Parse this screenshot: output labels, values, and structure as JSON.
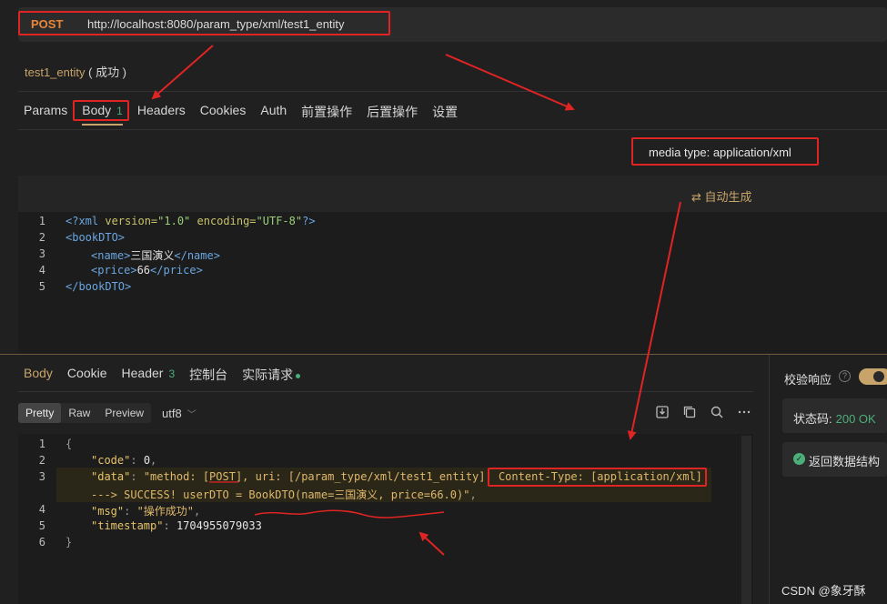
{
  "request": {
    "method": "POST",
    "url": "http://localhost:8080/param_type/xml/test1_entity",
    "name": "test1_entity",
    "status": "( 成功 )",
    "tabs": [
      {
        "label": "Params"
      },
      {
        "label": "Body",
        "badge": "1"
      },
      {
        "label": "Headers"
      },
      {
        "label": "Cookies"
      },
      {
        "label": "Auth"
      },
      {
        "label": "前置操作"
      },
      {
        "label": "后置操作"
      },
      {
        "label": "设置"
      }
    ],
    "media_type": "media type: application/xml",
    "autogen_label": "自动生成",
    "body_lines": [
      {
        "n": "1"
      },
      {
        "n": "2"
      },
      {
        "n": "3"
      },
      {
        "n": "4"
      },
      {
        "n": "5"
      }
    ],
    "xml": {
      "decl_open": "<?xml",
      "version_attr": " version=",
      "version_val": "\"1.0\"",
      "encoding_attr": " encoding=",
      "encoding_val": "\"UTF-8\"",
      "decl_close": "?>",
      "root_open": "<bookDTO>",
      "name_open": "<name>",
      "name_val": "三国演义",
      "name_close": "</name>",
      "price_open": "<price>",
      "price_val": "66",
      "price_close": "</price>",
      "root_close": "</bookDTO>"
    }
  },
  "response": {
    "tabs": [
      {
        "label": "Body"
      },
      {
        "label": "Cookie"
      },
      {
        "label": "Header",
        "badge": "3"
      },
      {
        "label": "控制台"
      },
      {
        "label": "实际请求"
      }
    ],
    "view_modes": [
      "Pretty",
      "Raw",
      "Preview"
    ],
    "encoding": "utf8",
    "line_numbers": [
      "1",
      "2",
      "3",
      "",
      "4",
      "5",
      "6"
    ],
    "json": {
      "open": "{",
      "code_key": "\"code\"",
      "code_val": "0",
      "data_key": "\"data\"",
      "data_val_1": "\"method: [POST], uri: [/param_type/xml/test1_entity], Content-Type: [application/xml]",
      "data_val_2": "---> SUCCESS! userDTO = BookDTO(name=三国演义, price=66.0)\"",
      "msg_key": "\"msg\"",
      "msg_val": "\"操作成功\"",
      "ts_key": "\"timestamp\"",
      "ts_val": "1704955079033",
      "close": "}"
    }
  },
  "side_panel": {
    "verify_label": "校验响应",
    "status_label": "状态码:",
    "status_value": "200 OK",
    "schema_label": "返回数据结构"
  },
  "watermark": "CSDN @象牙酥",
  "colors": {
    "accent": "#c8a46a",
    "method": "#e8873a",
    "success": "#4caf7a",
    "annotation": "#e02424"
  }
}
